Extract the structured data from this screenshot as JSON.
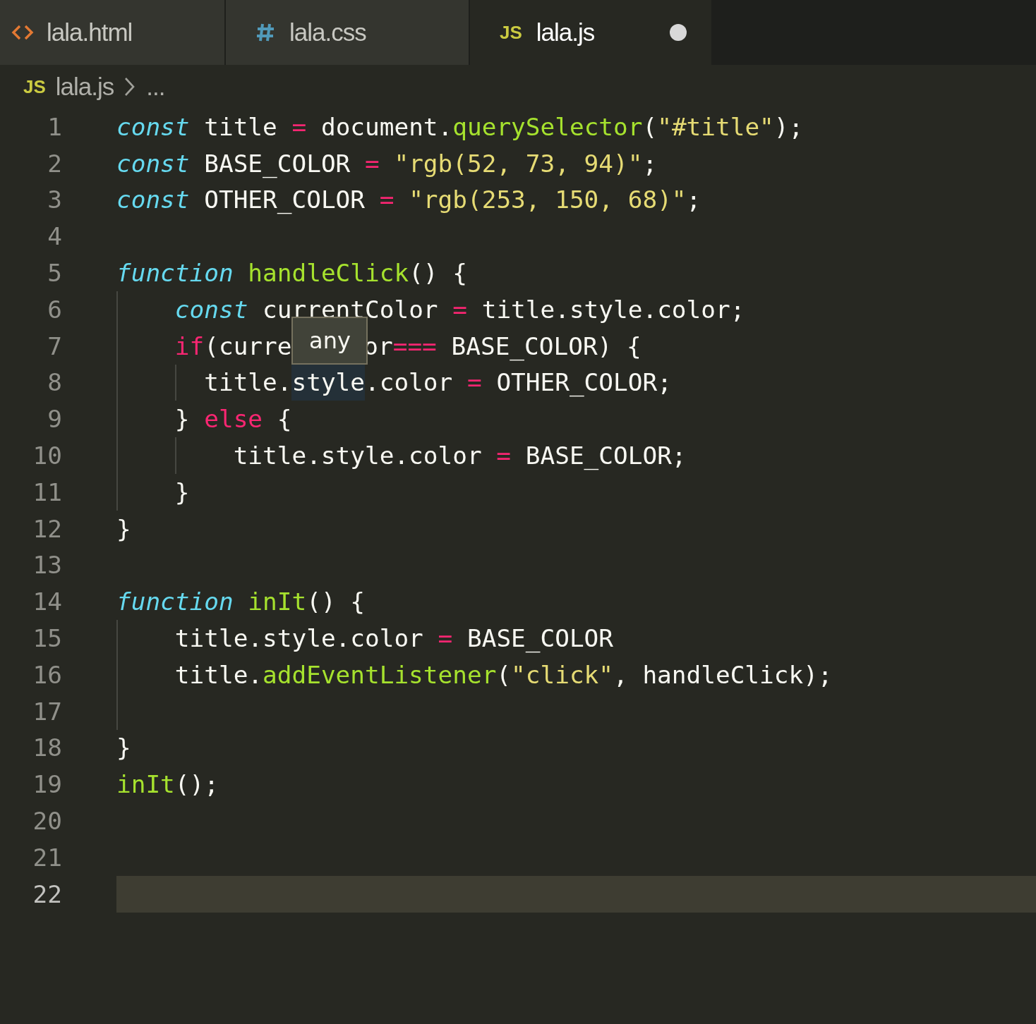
{
  "tabs": [
    {
      "kind": "html",
      "label": "lala.html",
      "selected": false,
      "modified": false
    },
    {
      "kind": "css",
      "label": "lala.css",
      "selected": false,
      "modified": false
    },
    {
      "kind": "js",
      "badge": "JS",
      "label": "lala.js",
      "selected": true,
      "modified": true
    }
  ],
  "breadcrumb": {
    "badge": "JS",
    "file": "lala.js",
    "more": "..."
  },
  "lines": [
    {
      "number": "1",
      "current": false,
      "tokens": [
        {
          "kind": "keyword",
          "text": "const"
        },
        {
          "kind": "plain",
          "text": " title "
        },
        {
          "kind": "op",
          "text": "="
        },
        {
          "kind": "plain",
          "text": " document."
        },
        {
          "kind": "func",
          "text": "querySelector"
        },
        {
          "kind": "plain",
          "text": "("
        },
        {
          "kind": "string",
          "text": "\"#title\""
        },
        {
          "kind": "plain",
          "text": ");"
        }
      ]
    },
    {
      "number": "2",
      "current": false,
      "tokens": [
        {
          "kind": "keyword",
          "text": "const"
        },
        {
          "kind": "plain",
          "text": " BASE_COLOR "
        },
        {
          "kind": "op",
          "text": "="
        },
        {
          "kind": "string",
          "text": " \"rgb(52, 73, 94)\""
        },
        {
          "kind": "plain",
          "text": ";"
        }
      ]
    },
    {
      "number": "3",
      "current": false,
      "tokens": [
        {
          "kind": "keyword",
          "text": "const"
        },
        {
          "kind": "plain",
          "text": " OTHER_COLOR "
        },
        {
          "kind": "op",
          "text": "="
        },
        {
          "kind": "string",
          "text": " \"rgb(253, 150, 68)\""
        },
        {
          "kind": "plain",
          "text": ";"
        }
      ]
    },
    {
      "number": "4",
      "current": false
    },
    {
      "number": "5",
      "current": false,
      "tokens": [
        {
          "kind": "keyword",
          "text": "function"
        },
        {
          "kind": "func",
          "text": " handleClick"
        },
        {
          "kind": "plain",
          "text": "() {"
        }
      ]
    },
    {
      "number": "6",
      "current": false,
      "tokens": [
        {
          "kind": "keyword",
          "text": "    const"
        },
        {
          "kind": "plain",
          "text": " currentColor "
        },
        {
          "kind": "op",
          "text": "="
        },
        {
          "kind": "plain",
          "text": " title.style.color;"
        }
      ]
    },
    {
      "number": "7",
      "current": false,
      "tokens": [
        {
          "kind": "op",
          "text": "    if"
        },
        {
          "kind": "plain",
          "text": "(curre"
        },
        {
          "kind": "tooltip",
          "text": "any"
        },
        {
          "kind": "plain",
          "text": "or"
        },
        {
          "kind": "op",
          "text": "==="
        },
        {
          "kind": "plain",
          "text": " BASE_COLOR) {"
        }
      ]
    },
    {
      "number": "8",
      "current": false,
      "tokens": [
        {
          "kind": "plain",
          "text": "      title."
        },
        {
          "kind": "highlight",
          "text": "style"
        },
        {
          "kind": "plain",
          "text": ".color "
        },
        {
          "kind": "op",
          "text": "="
        },
        {
          "kind": "plain",
          "text": " OTHER_COLOR;"
        }
      ]
    },
    {
      "number": "9",
      "current": false,
      "tokens": [
        {
          "kind": "plain",
          "text": "    } "
        },
        {
          "kind": "op",
          "text": "else"
        },
        {
          "kind": "plain",
          "text": " {"
        }
      ]
    },
    {
      "number": "10",
      "current": false,
      "tokens": [
        {
          "kind": "plain",
          "text": "        title.style.color "
        },
        {
          "kind": "op",
          "text": "="
        },
        {
          "kind": "plain",
          "text": " BASE_COLOR;"
        }
      ]
    },
    {
      "number": "11",
      "current": false,
      "tokens": [
        {
          "kind": "plain",
          "text": "    }"
        }
      ]
    },
    {
      "number": "12",
      "current": false,
      "tokens": [
        {
          "kind": "plain",
          "text": "}"
        }
      ]
    },
    {
      "number": "13",
      "current": false
    },
    {
      "number": "14",
      "current": false,
      "tokens": [
        {
          "kind": "keyword",
          "text": "function"
        },
        {
          "kind": "func",
          "text": " inIt"
        },
        {
          "kind": "plain",
          "text": "() {"
        }
      ]
    },
    {
      "number": "15",
      "current": false,
      "tokens": [
        {
          "kind": "plain",
          "text": "    title.style.color "
        },
        {
          "kind": "op",
          "text": "="
        },
        {
          "kind": "plain",
          "text": " BASE_COLOR"
        }
      ]
    },
    {
      "number": "16",
      "current": false,
      "tokens": [
        {
          "kind": "plain",
          "text": "    title."
        },
        {
          "kind": "func",
          "text": "addEventListener"
        },
        {
          "kind": "plain",
          "text": "("
        },
        {
          "kind": "string",
          "text": "\"click\""
        },
        {
          "kind": "plain",
          "text": ", handleClick);"
        }
      ]
    },
    {
      "number": "17",
      "current": false
    },
    {
      "number": "18",
      "current": false,
      "tokens": [
        {
          "kind": "plain",
          "text": "}"
        }
      ]
    },
    {
      "number": "19",
      "current": false,
      "tokens": [
        {
          "kind": "func",
          "text": "inIt"
        },
        {
          "kind": "plain",
          "text": "();"
        }
      ]
    },
    {
      "number": "20",
      "current": false
    },
    {
      "number": "21",
      "current": false
    },
    {
      "number": "22",
      "current": true
    }
  ]
}
